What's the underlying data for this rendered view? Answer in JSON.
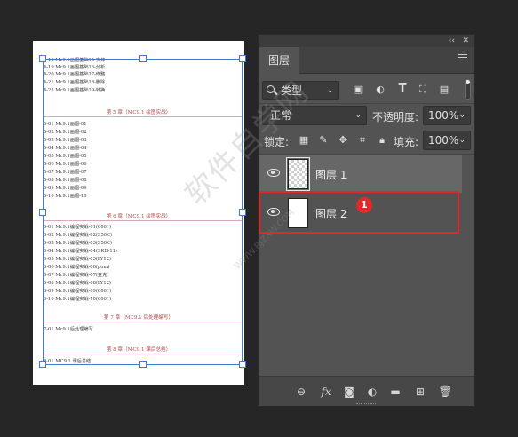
{
  "document": {
    "lines_top": [
      "4-18 Mc9.1画图基础15-实体",
      "4-19 Mc9.1画图基础16-分析",
      "4-20 Mc9.1画图基础17-修整",
      "4-21 Mc9.1画图基础18-删除",
      "4-22 Mc9.1画图基础19-转换"
    ],
    "chapter5": "第 5 章（MC9.1 绘图实战）",
    "lines_ch5": [
      "5-01 Mc9.1画图-01",
      "5-02 Mc9.1画图-02",
      "5-03 Mc9.1画图-03",
      "5-04 Mc9.1画图-04",
      "5-05 Mc9.1画图-05",
      "5-06 Mc9.1画图-06",
      "5-07 Mc9.1画图-07",
      "5-08 Mc9.1画图-08",
      "5-09 Mc9.1画图-09",
      "5-10 Mc9.1画图-10"
    ],
    "chapter6": "第 6 章（MC9.1 绘图实战）",
    "lines_ch6": [
      "6-01 Mc9.1编程实战-01(6061)",
      "6-02 Mc9.1编程实战-02(S50C)",
      "6-03 Mc9.1编程实战-03(S50C)",
      "6-04 Mc9.1编程实战-04(SKD-11)",
      "6-05 Mc9.1编程实战-05(LY12)",
      "6-06 Mc9.1编程实战-06(pom)",
      "6-07 Mc9.1编程实战-07(亚克)",
      "6-08 Mc9.1编程实战-08(LY12)",
      "6-09 Mc9.1编程实战-09(6061)",
      "6-10 Mc9.1编程实战-10(6061)"
    ],
    "chapter7": "第 7 章（MC9.1 后处理编写）",
    "lines_ch7": [
      "7-01 Mc9.1后处理编写"
    ],
    "chapter8": "第 8 章（MC9.1 课后总结）",
    "lines_ch8": [
      "8-01 MC9.1 课后总结"
    ]
  },
  "watermark": {
    "text": "软件自学网",
    "url": "WWW.RJZXW.COM"
  },
  "panel": {
    "collapse_glyph": "‹‹",
    "close_glyph": "✕",
    "tab_label": "图层",
    "filter_label": "类型",
    "blend_mode": "正常",
    "opacity_label": "不透明度:",
    "opacity_value": "100%",
    "lock_label": "锁定:",
    "fill_label": "填充:",
    "fill_value": "100%",
    "layers": [
      {
        "name": "图层 1",
        "thumb": "transparent",
        "visible": true,
        "selected": true
      },
      {
        "name": "图层 2",
        "thumb": "white",
        "visible": true,
        "selected": false
      }
    ],
    "callout_number": "1",
    "footer_fx": "fx"
  },
  "colors": {
    "background": "#262626",
    "panel": "#535353",
    "selected_layer": "#676767",
    "highlight": "#e02a2a",
    "transform_box": "#3a7bd5"
  }
}
